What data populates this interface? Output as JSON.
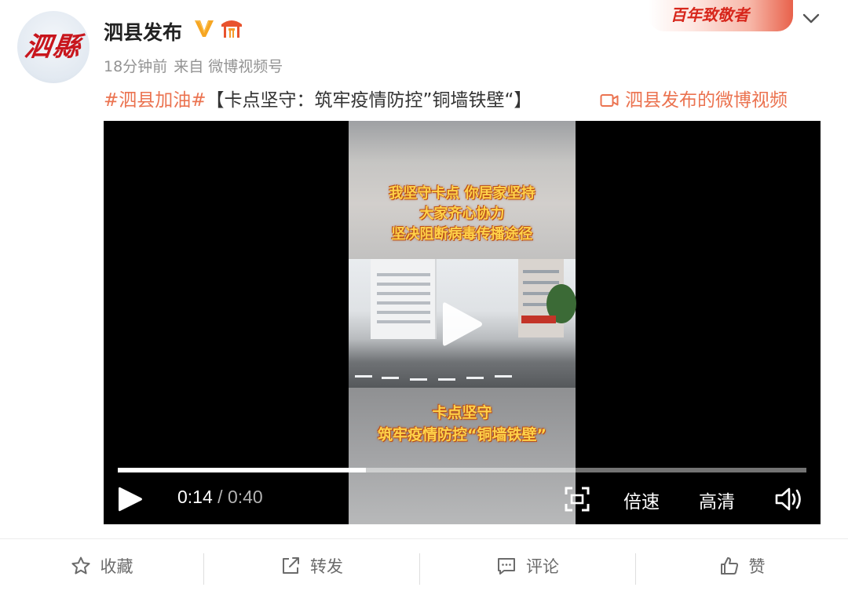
{
  "post": {
    "author": {
      "avatar_text": "泗縣",
      "name": "泗县发布",
      "verified_icon": "verified-v-icon",
      "badge_icon": "gate-badge-icon"
    },
    "meta": {
      "time": "18分钟前",
      "source": "来自 微博视频号"
    },
    "promo_banner": "百年致敬者",
    "text": {
      "hashtag": "#泗县加油#",
      "body": "【卡点坚守：筑牢疫情防控”铜墙铁壁“】"
    },
    "video_link": "泗县发布的微博视频"
  },
  "video": {
    "caption_top": [
      "我坚守卡点  你居家坚持",
      "大家齐心协力",
      "坚决阻断病毒传播途径"
    ],
    "caption_bottom": [
      "卡点坚守",
      "筑牢疫情防控“铜墙铁壁”"
    ],
    "current_time": "0:14",
    "separator": " / ",
    "duration": "0:40",
    "progress": 0.36,
    "speed_label": "倍速",
    "quality_label": "高清"
  },
  "actions": {
    "favorite": "收藏",
    "repost": "转发",
    "comment": "评论",
    "like": "赞"
  },
  "colors": {
    "accent": "#eb7350",
    "verified": "#f6a623"
  }
}
